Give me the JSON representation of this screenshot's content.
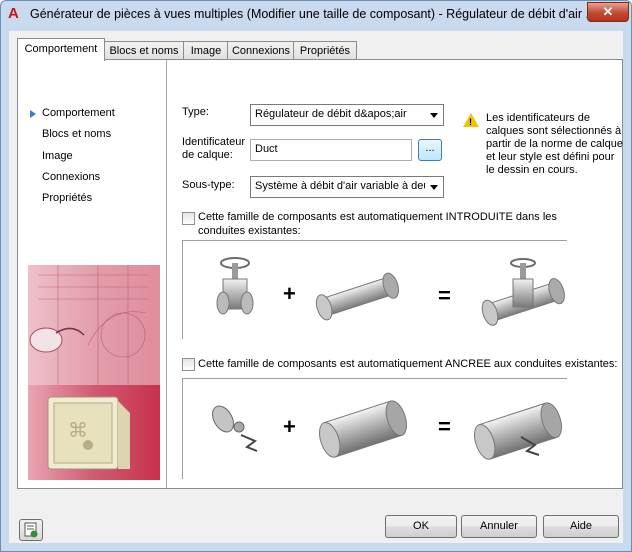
{
  "window": {
    "title": "Générateur de pièces à vues multiples (Modifier une taille de composant) - Régulateur de débit d'air ...",
    "close_glyph": "✕"
  },
  "tabs": [
    "Comportement",
    "Blocs et noms",
    "Image",
    "Connexions",
    "Propriétés"
  ],
  "nav": {
    "items": [
      "Comportement",
      "Blocs et noms",
      "Image",
      "Connexions",
      "Propriétés"
    ]
  },
  "form": {
    "type_label": "Type:",
    "type_value": "Régulateur de débit d&apos;air",
    "layer_label_line1": "Identificateur",
    "layer_label_line2": "de calque:",
    "layer_value": "Duct",
    "browse_label": "...",
    "subtype_label": "Sous-type:",
    "subtype_value": "Système à débit d'air variable à deu"
  },
  "info": {
    "text": "Les identificateurs de calques sont sélectionnés à partir de la norme de calque et leur style est défini pour le dessin en cours."
  },
  "check1": {
    "label_line1": "Cette famille de composants est automatiquement INTRODUITE dans les",
    "label_line2": "conduites existantes:"
  },
  "check2": {
    "label": "Cette famille de composants est automatiquement ANCREE aux conduites existantes:"
  },
  "operators": {
    "plus": "+",
    "equals": "="
  },
  "buttons": {
    "ok": "OK",
    "cancel": "Annuler",
    "help": "Aide"
  },
  "colors": {
    "titlebar": "#c9d9ee",
    "close": "#c44a33",
    "nav_arrow": "#3a7bd5",
    "warning": "#f5c400",
    "image_red": "#c8324c"
  }
}
